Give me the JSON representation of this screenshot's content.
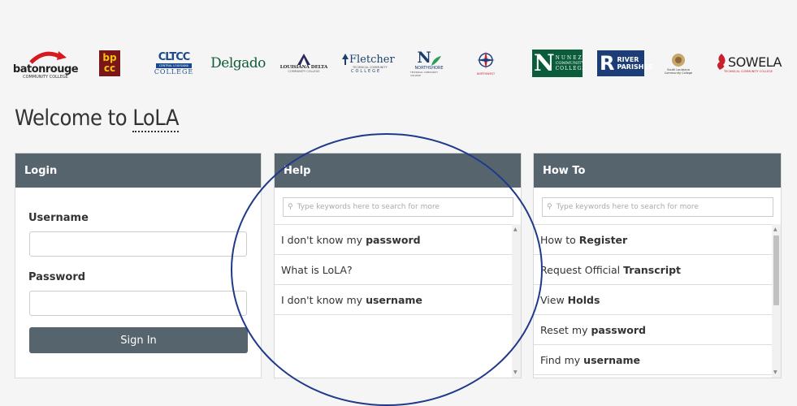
{
  "logos": {
    "baton_rouge": {
      "name": "batonrouge",
      "sub": "COMMUNITY COLLEGE"
    },
    "bpcc": {
      "text": "bp cc"
    },
    "cltcc": {
      "top": "CLTCC",
      "sub": "CENTRAL LOUISIANA",
      "bottom": "COLLEGE"
    },
    "delgado": {
      "text": "Delgado"
    },
    "ladelta": {
      "name": "LOUISIANA DELTA",
      "sub": "COMMUNITY COLLEGE"
    },
    "fletcher": {
      "name": "Fletcher",
      "sub": "TECHNICAL COMMUNITY",
      "bottom": "COLLEGE"
    },
    "northshore": {
      "name": "NORTHSHORE",
      "sub": "TECHNICAL COMMUNITY COLLEGE"
    },
    "northwest": {
      "name": "NORTHWEST"
    },
    "nunez": {
      "line1": "NUNEZ",
      "line2": "COMMUNITY",
      "line3": "COLLEGE"
    },
    "river_parishes": {
      "line1": "RIVER",
      "line2": "PARISHES"
    },
    "south_louisiana": {
      "line1": "South Louisiana",
      "line2": "Community College"
    },
    "sowela": {
      "name": "SOWELA",
      "sub": "TECHNICAL COMMUNITY COLLEGE"
    }
  },
  "page": {
    "title_prefix": "Welcome to ",
    "title_abbr": "LoLA"
  },
  "login": {
    "header": "Login",
    "username_label": "Username",
    "password_label": "Password",
    "sign_in_label": "Sign In"
  },
  "help": {
    "header": "Help",
    "search_placeholder": "Type keywords here to search for more",
    "items": [
      {
        "prefix": "I don't know my",
        "bold": "password"
      },
      {
        "prefix": "What is LoLA?",
        "bold": ""
      },
      {
        "prefix": "I don't know my",
        "bold": "username"
      }
    ]
  },
  "howto": {
    "header": "How To",
    "search_placeholder": "Type keywords here to search for more",
    "items": [
      {
        "prefix": "How to",
        "bold": "Register"
      },
      {
        "prefix": "Request Official",
        "bold": "Transcript"
      },
      {
        "prefix": "View",
        "bold": "Holds"
      },
      {
        "prefix": "Reset my",
        "bold": "password"
      },
      {
        "prefix": "Find my",
        "bold": "username"
      }
    ]
  },
  "colors": {
    "panel_header": "#56646e",
    "annotation_circle": "#1f3a8a",
    "background": "#f5f5f5"
  },
  "icons": {
    "search": "search-icon",
    "scroll_up": "triangle-up-icon",
    "scroll_down": "triangle-down-icon"
  }
}
